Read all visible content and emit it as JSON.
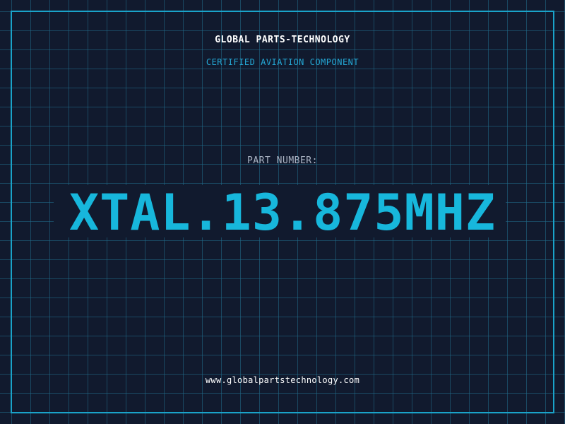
{
  "header": {
    "company": "GLOBAL PARTS-TECHNOLOGY",
    "subtitle": "CERTIFIED AVIATION COMPONENT"
  },
  "part": {
    "label": "PART NUMBER:",
    "number": "XTAL.13.875MHZ"
  },
  "footer": {
    "website": "www.globalpartstechnology.com"
  },
  "colors": {
    "background": "#111a2e",
    "accent": "#17b7dc",
    "grid": "#206e8c",
    "text": "#ffffff",
    "label": "#aab3c3"
  }
}
